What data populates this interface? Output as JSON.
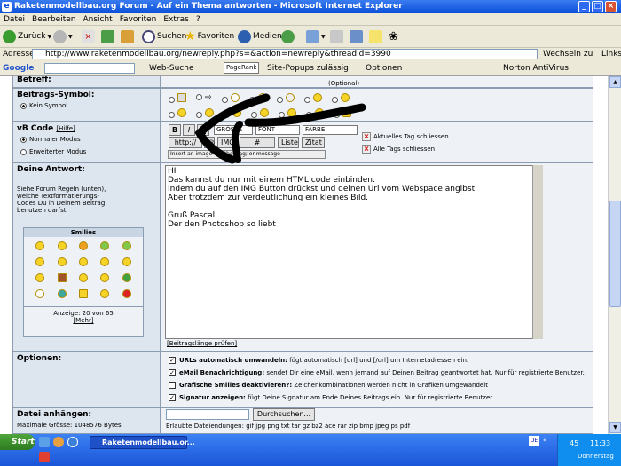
{
  "window": {
    "title": "Raketenmodellbau.org Forum - Auf ein Thema antworten - Microsoft Internet Explorer"
  },
  "menu": [
    "Datei",
    "Bearbeiten",
    "Ansicht",
    "Favoriten",
    "Extras",
    "?"
  ],
  "toolbar": {
    "back": "Zurück",
    "search": "Suchen",
    "favorites": "Favoriten",
    "media": "Medien"
  },
  "address": {
    "label": "Adresse",
    "url": "http://www.raketenmodellbau.org/newreply.php?s=&action=newreply&threadid=3990",
    "go": "Wechseln zu",
    "links": "Links"
  },
  "google": {
    "label": "Google",
    "web_search": "Web-Suche",
    "pagerank": "PageRank",
    "popups": "Site-Popups zulässig",
    "options": "Optionen",
    "norton": "Norton AntiVirus"
  },
  "form": {
    "subject_label": "Betreff:",
    "optional": "(Optional)",
    "icon_label": "Beitrags-Symbol:",
    "icon_none": "Kein Symbol",
    "vbcode_label": "vB Code",
    "vbcode_help": "[Hilfe]",
    "normal_mode": "Normaler Modus",
    "extended_mode": "Erweiterter Modus",
    "btn_b": "B",
    "btn_i": "I",
    "btn_u": "U",
    "size_select": "GRÖSSE",
    "font_select": "FONT",
    "color_select": "FARBE",
    "btn_http": "http://",
    "btn_at": "@",
    "btn_img": "IMG",
    "btn_hash": "#",
    "btn_list": "Liste",
    "btn_quote": "Zitat",
    "close_current": "Aktuelles Tag schliessen",
    "close_all": "Alle Tags schliessen",
    "hint": "Insert an image or other tag; or message",
    "answer_label": "Deine Antwort:",
    "rules_text": "Siehe Forum Regeln (unten), welche Textformatierungs-Codes Du in Deinem Beitrag benutzen darfst.",
    "smilies_title": "Smilies",
    "smilies_count": "Anzeige: 20 von 65",
    "smilies_more": "[Mehr]",
    "message": "HI\nDas kannst du nur mit einem HTML code einbinden.\nIndem du auf den IMG Button drückst und deinen Url vom Webspace angibst.\nAber trotzdem zur verdeutlichung ein kleines Bild.\n\nGruß Pascal\nDer den Photoshop so liebt",
    "check_length": "[Beitragslänge prüfen]",
    "options_label": "Optionen:",
    "opt1_b": "URLs automatisch umwandeln:",
    "opt1": " fügt automatisch [url] und [/url] um Internetadressen ein.",
    "opt2_b": "eMail Benachrichtigung:",
    "opt2": " sendet Dir eine eMail, wenn jemand auf Deinen Beitrag geantwortet hat. Nur für registrierte Benutzer.",
    "opt3_b": "Grafische Smilies deaktivieren?:",
    "opt3": " Zeichenkombinationen werden nicht in Grafiken umgewandelt",
    "opt4_b": "Signatur anzeigen:",
    "opt4": " fügt Deine Signatur am Ende Deines Beitrags ein. Nur für registrierte Benutzer.",
    "attach_label": "Datei anhängen:",
    "max_size": "Maximale Grösse: 1048576 Bytes",
    "browse": "Durchsuchen...",
    "allowed": "Erlaubte Dateiendungen: gif jpg png txt tar gz bz2 ace rar zip bmp jpeg ps pdf"
  },
  "taskbar": {
    "start": "Start",
    "window": "Raketenmodellbau.or...",
    "lang": "DE",
    "time": "11:33",
    "day": "Donnerstag",
    "num": "45"
  },
  "colors": {
    "title_blue": "#0a4fd8",
    "label_bg": "#dde5ee",
    "field_bg": "#eef2f7"
  }
}
